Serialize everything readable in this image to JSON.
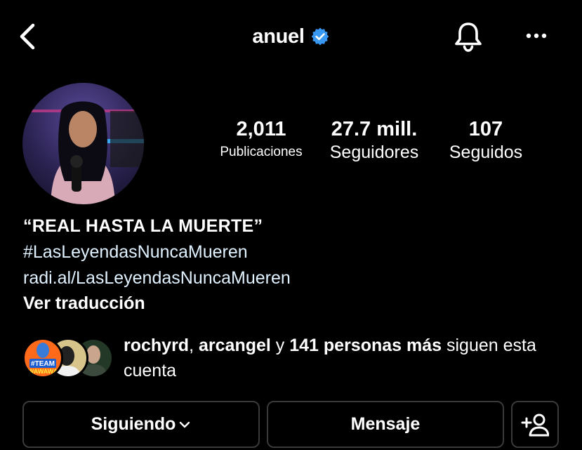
{
  "header": {
    "username": "anuel",
    "icons": {
      "back": "back-chevron-icon",
      "verified": "verified-badge-icon",
      "notifications": "bell-icon",
      "more": "more-options-icon"
    },
    "verified_color": "#3897f0"
  },
  "profile": {
    "avatar": "profile-avatar",
    "stats": {
      "posts": {
        "value": "2,011",
        "label": "Publicaciones"
      },
      "followers": {
        "value": "27.7 mill.",
        "label": "Seguidores"
      },
      "following": {
        "value": "107",
        "label": "Seguidos"
      }
    },
    "bio": {
      "quote": "“REAL HASTA LA MUERTE”",
      "hashtag": "#LasLeyendasNuncaMueren",
      "link": "radi.al/LasLeyendasNuncaMueren",
      "translate": "Ver traducción"
    },
    "followed_by": {
      "user1": "rochyrd",
      "sep": ", ",
      "user2": "arcangel",
      "connector": " y ",
      "others": "141 personas más",
      "suffix": " siguen esta cuenta",
      "avatar_text": "#TEAM WAWAWA"
    }
  },
  "actions": {
    "following": "Siguiendo",
    "message": "Mensaje",
    "add_user_icon": "add-person-icon"
  },
  "colors": {
    "background": "#000000",
    "text": "#ffffff",
    "link": "#e0f1ff",
    "button_border": "#3a3a3c"
  }
}
